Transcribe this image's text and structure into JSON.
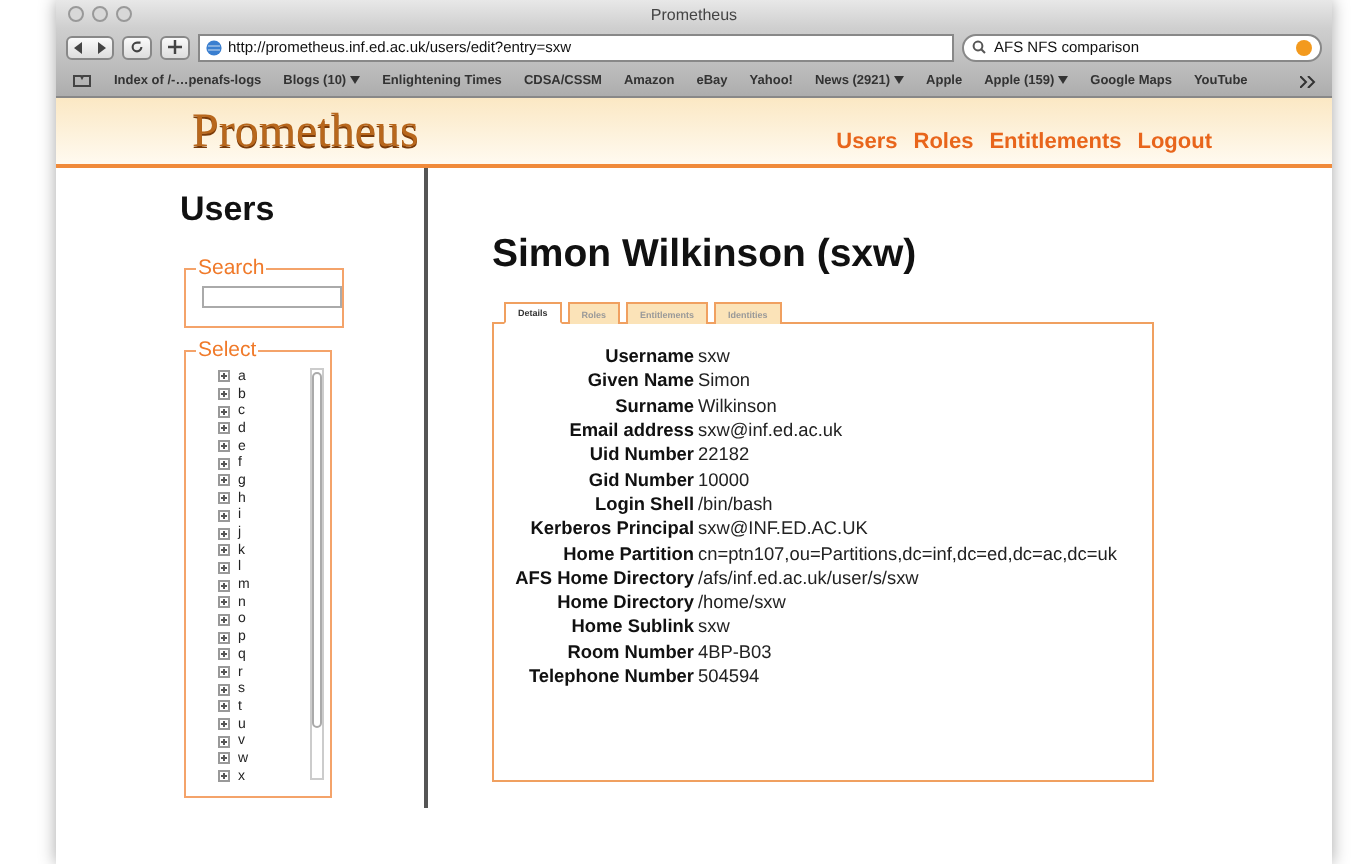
{
  "window": {
    "title": "Prometheus"
  },
  "toolbar": {
    "url": "http://prometheus.inf.ed.ac.uk/users/edit?entry=sxw",
    "search": "AFS NFS comparison"
  },
  "bookmarks": [
    {
      "label": "Index of /-…penafs-logs",
      "menu": false
    },
    {
      "label": "Blogs (10)",
      "menu": true
    },
    {
      "label": "Enlightening Times",
      "menu": false
    },
    {
      "label": "CDSA/CSSM",
      "menu": false
    },
    {
      "label": "Amazon",
      "menu": false
    },
    {
      "label": "eBay",
      "menu": false
    },
    {
      "label": "Yahoo!",
      "menu": false
    },
    {
      "label": "News (2921)",
      "menu": true
    },
    {
      "label": "Apple",
      "menu": false
    },
    {
      "label": "Apple (159)",
      "menu": true
    },
    {
      "label": "Google Maps",
      "menu": false
    },
    {
      "label": "YouTube",
      "menu": false
    }
  ],
  "site": {
    "logo": "Prometheus",
    "nav": [
      "Users",
      "Roles",
      "Entitlements",
      "Logout"
    ]
  },
  "page_heading": "Users",
  "search_box": {
    "legend": "Search"
  },
  "select_box": {
    "legend": "Select",
    "items": [
      {
        "label": "a",
        "expanded": false
      },
      {
        "label": "b",
        "expanded": false
      },
      {
        "label": "c",
        "expanded": false
      },
      {
        "label": "d",
        "expanded": false
      },
      {
        "label": "e",
        "expanded": false
      },
      {
        "label": "f",
        "expanded": false
      },
      {
        "label": "g",
        "expanded": false
      },
      {
        "label": "h",
        "expanded": false
      },
      {
        "label": "i",
        "expanded": false
      },
      {
        "label": "j",
        "expanded": false
      },
      {
        "label": "k",
        "expanded": false
      },
      {
        "label": "l",
        "expanded": false
      },
      {
        "label": "m",
        "expanded": false
      },
      {
        "label": "n",
        "expanded": false
      },
      {
        "label": "o",
        "expanded": false
      },
      {
        "label": "p",
        "expanded": false
      },
      {
        "label": "q",
        "expanded": false
      },
      {
        "label": "r",
        "expanded": false
      },
      {
        "label": "s",
        "expanded": false
      },
      {
        "label": "t",
        "expanded": false
      },
      {
        "label": "u",
        "expanded": false
      },
      {
        "label": "v",
        "expanded": false
      },
      {
        "label": "w",
        "expanded": false
      },
      {
        "label": "x",
        "expanded": false
      }
    ]
  },
  "user": {
    "heading": "Simon Wilkinson (sxw)",
    "tabs": [
      {
        "label": "Details",
        "selected": true
      },
      {
        "label": "Roles",
        "selected": false
      },
      {
        "label": "Entitlements",
        "selected": false
      },
      {
        "label": "Identities",
        "selected": false
      }
    ],
    "fields": [
      {
        "label": "Username",
        "value": "sxw"
      },
      {
        "label": "Given Name",
        "value": "Simon"
      },
      {
        "label": "Surname",
        "value": "Wilkinson"
      },
      {
        "label": "Email address",
        "value": "sxw@inf.ed.ac.uk"
      },
      {
        "label": "Uid Number",
        "value": "22182"
      },
      {
        "label": "Gid Number",
        "value": "10000"
      },
      {
        "label": "Login Shell",
        "value": "/bin/bash"
      },
      {
        "label": "Kerberos Principal",
        "value": "sxw@INF.ED.AC.UK"
      },
      {
        "label": "Home Partition",
        "value": "cn=ptn107,ou=Partitions,dc=inf,dc=ed,dc=ac,dc=uk"
      },
      {
        "label": "AFS Home Directory",
        "value": "/afs/inf.ed.ac.uk/user/s/sxw"
      },
      {
        "label": "Home Directory",
        "value": "/home/sxw"
      },
      {
        "label": "Home Sublink",
        "value": "sxw"
      },
      {
        "label": "Room Number",
        "value": "4BP-B03"
      },
      {
        "label": "Telephone Number",
        "value": "504594"
      }
    ]
  }
}
